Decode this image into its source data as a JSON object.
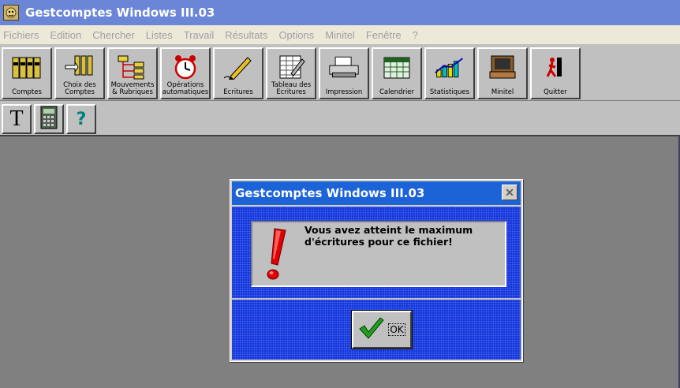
{
  "window": {
    "title": "Gestcomptes Windows III.03"
  },
  "menu": [
    "Fichiers",
    "Edition",
    "Chercher",
    "Listes",
    "Travail",
    "Résultats",
    "Options",
    "Minitel",
    "Fenêtre",
    "?"
  ],
  "toolbar": [
    {
      "name": "comptes",
      "label": "Comptes",
      "icon": "ledgers-icon"
    },
    {
      "name": "choix-des-comptes",
      "label": "Choix des\nComptes",
      "icon": "hand-pointer-icon"
    },
    {
      "name": "mouvements-rubriques",
      "label": "Mouvements\n& Rubriques",
      "icon": "tree-icon"
    },
    {
      "name": "operations-automatiques",
      "label": "Opérations\nautomatiques",
      "icon": "alarm-clock-icon"
    },
    {
      "name": "ecritures",
      "label": "Ecritures",
      "icon": "pen-icon"
    },
    {
      "name": "tableau-des-ecritures",
      "label": "Tableau des\nEcritures",
      "icon": "spreadsheet-icon"
    },
    {
      "name": "impression",
      "label": "Impression",
      "icon": "printer-icon"
    },
    {
      "name": "calendrier",
      "label": "Calendrier",
      "icon": "calendar-icon"
    },
    {
      "name": "statistiques",
      "label": "Statistiques",
      "icon": "chart-icon"
    },
    {
      "name": "minitel",
      "label": "Minitel",
      "icon": "minitel-icon"
    },
    {
      "name": "quitter",
      "label": "Quitter",
      "icon": "exit-icon"
    }
  ],
  "toolbar2": {
    "text_glyph": "T",
    "help_glyph": "?"
  },
  "dialog": {
    "title": "Gestcomptes Windows III.03",
    "close_glyph": "✕",
    "message_line1": "Vous avez atteint le maximum",
    "message_line2": "d'écritures pour ce fichier!",
    "ok_label": "OK"
  },
  "colors": {
    "titlebar": "#6b86d6",
    "dialog_title": "#1b63d6",
    "dialog_body": "#1535d8",
    "desktop": "#808080"
  }
}
